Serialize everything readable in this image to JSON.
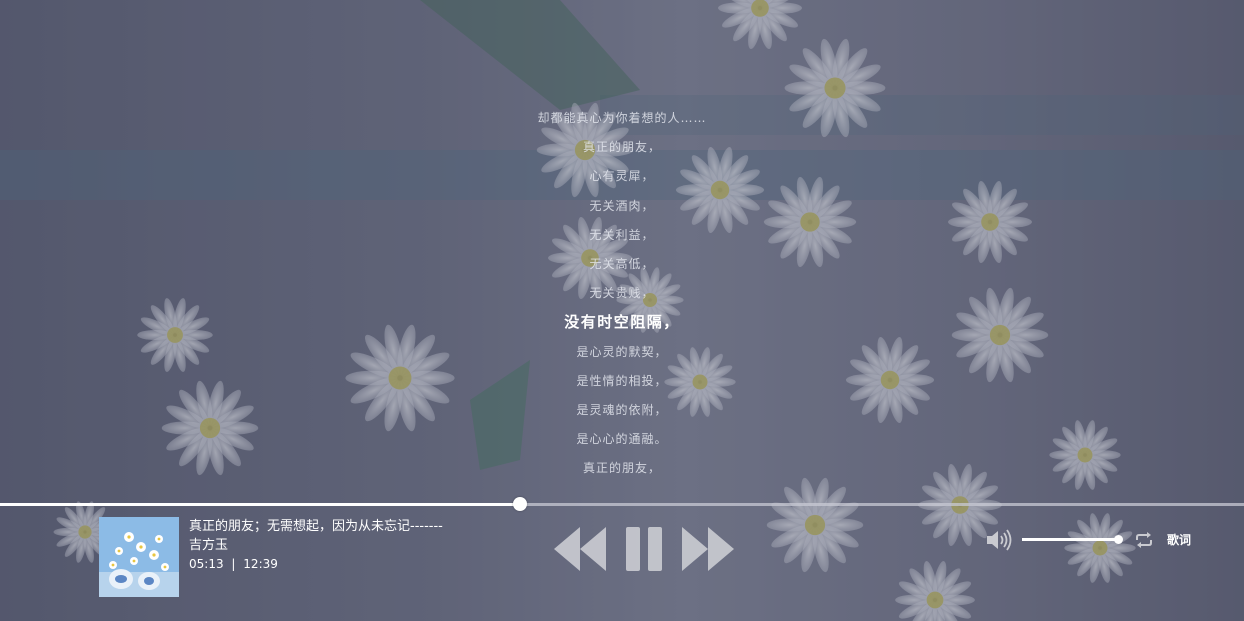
{
  "lyrics": [
    "却都能真心为你着想的人……",
    "真正的朋友，",
    "心有灵犀，",
    "无关酒肉，",
    "无关利益，",
    "无关高低，",
    "无关贵贱，",
    "没有时空阻隔，",
    "是心灵的默契，",
    "是性情的相投，",
    "是灵魂的依附，",
    "是心心的通融。",
    "真正的朋友，"
  ],
  "active_lyric_index": 7,
  "player": {
    "song_title": "真正的朋友；无需想起，因为从未忘记-------",
    "artist": "吉方玉",
    "current_time": "05:13",
    "separator": "|",
    "total_time": "12:39",
    "progress": 0.418,
    "volume": 1.0,
    "lyrics_toggle_label": "歌词"
  },
  "icons": {
    "prev": "rewind-icon",
    "pause": "pause-icon",
    "next": "fast-forward-icon",
    "volume": "speaker-icon",
    "loop": "repeat-icon"
  },
  "colors": {
    "accent": "#ffffff",
    "background": "#5a5d72",
    "control_gray": "#c9cad0"
  }
}
